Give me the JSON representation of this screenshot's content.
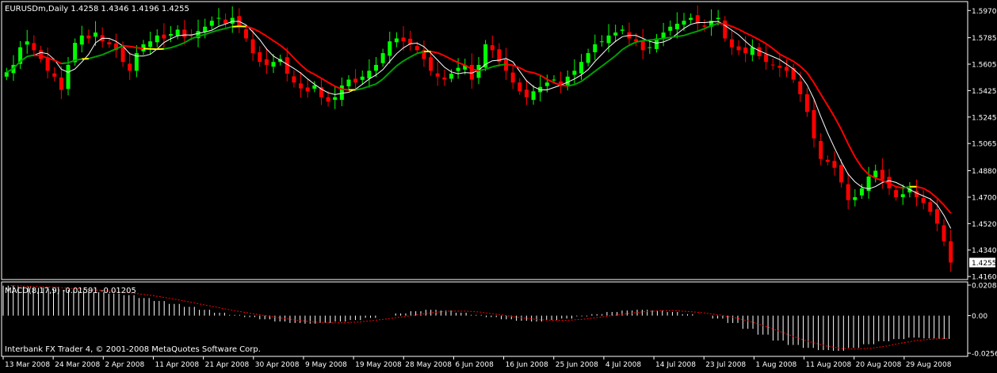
{
  "header": {
    "symbol_line": "EURUSDm,Daily  1.4258 1.4346 1.4196 1.4255"
  },
  "macd": {
    "label": "MACD(8,17,9) -0.01591 -0.01205",
    "scale_labels": [
      "0.02084",
      "0.00",
      "-0.02563"
    ]
  },
  "footer": {
    "copyright": "Interbank FX Trader 4, © 2001-2008 MetaQuotes Software Corp."
  },
  "colors": {
    "background": "#000000",
    "frame": "#ffffff",
    "bull_candle": "#00ff00",
    "bear_candle": "#ff0000",
    "ma_fast": "#ffffff",
    "ma_slow_up": "#00a000",
    "ma_slow_down": "#ff0000",
    "ma_slow_flat": "#ffff00",
    "macd_hist": "#ffffff",
    "macd_signal": "#ff0000"
  },
  "chart_data": {
    "type": "candlestick",
    "title": "EURUSDm,Daily",
    "price_axis_labels": [
      "1.5970",
      "1.5785",
      "1.5605",
      "1.5425",
      "1.5245",
      "1.5065",
      "1.4880",
      "1.4700",
      "1.4520",
      "1.4340",
      "1.4160"
    ],
    "current_price": "1.4255",
    "ylim": [
      1.415,
      1.602
    ],
    "date_labels": [
      "13 Mar 2008",
      "24 Mar 2008",
      "2 Apr 2008",
      "11 Apr 2008",
      "21 Apr 2008",
      "30 Apr 2008",
      "9 May 2008",
      "19 May 2008",
      "28 May 2008",
      "6 Jun 2008",
      "16 Jun 2008",
      "25 Jun 2008",
      "4 Jul 2008",
      "14 Jul 2008",
      "23 Jul 2008",
      "1 Aug 2008",
      "11 Aug 2008",
      "20 Aug 2008",
      "29 Aug 2008"
    ],
    "close_series": [
      1.555,
      1.56,
      1.572,
      1.576,
      1.57,
      1.564,
      1.556,
      1.552,
      1.543,
      1.56,
      1.575,
      1.58,
      1.578,
      1.582,
      1.576,
      1.574,
      1.57,
      1.562,
      1.556,
      1.568,
      1.574,
      1.576,
      1.58,
      1.578,
      1.581,
      1.584,
      1.579,
      1.58,
      1.583,
      1.586,
      1.59,
      1.592,
      1.588,
      1.592,
      1.586,
      1.578,
      1.568,
      1.562,
      1.56,
      1.562,
      1.564,
      1.554,
      1.548,
      1.544,
      1.542,
      1.546,
      1.538,
      1.535,
      1.538,
      1.546,
      1.55,
      1.548,
      1.552,
      1.556,
      1.56,
      1.568,
      1.576,
      1.578,
      1.576,
      1.574,
      1.57,
      1.564,
      1.556,
      1.552,
      1.55,
      1.554,
      1.558,
      1.56,
      1.55,
      1.56,
      1.574,
      1.57,
      1.562,
      1.556,
      1.548,
      1.542,
      1.538,
      1.542,
      1.545,
      1.548,
      1.55,
      1.546,
      1.552,
      1.556,
      1.562,
      1.568,
      1.574,
      1.576,
      1.58,
      1.582,
      1.584,
      1.578,
      1.576,
      1.57,
      1.572,
      1.578,
      1.582,
      1.586,
      1.588,
      1.59,
      1.592,
      1.588,
      1.586,
      1.59,
      1.592,
      1.578,
      1.572,
      1.57,
      1.568,
      1.572,
      1.566,
      1.562,
      1.56,
      1.558,
      1.556,
      1.55,
      1.54,
      1.528,
      1.51,
      1.496,
      1.494,
      1.49,
      1.48,
      1.468,
      1.47,
      1.476,
      1.484,
      1.488,
      1.482,
      1.476,
      1.47,
      1.472,
      1.476,
      1.47,
      1.466,
      1.46,
      1.452,
      1.44,
      1.4255
    ],
    "macd_histogram": [
      0.0205,
      0.0198,
      0.019,
      0.0182,
      0.0176,
      0.017,
      0.016,
      0.015,
      0.014,
      0.012,
      0.01,
      0.008,
      0.006,
      0.004,
      0.002,
      0.0005,
      -0.001,
      -0.0025,
      -0.004,
      -0.005,
      -0.0055,
      -0.005,
      -0.004,
      -0.003,
      -0.0015,
      0.0,
      0.0015,
      0.003,
      0.004,
      0.0035,
      0.002,
      0.0005,
      -0.001,
      -0.0025,
      -0.0035,
      -0.004,
      -0.003,
      -0.002,
      -0.0005,
      0.001,
      0.0025,
      0.0035,
      0.004,
      0.0035,
      0.0025,
      0.001,
      0.0,
      -0.002,
      -0.005,
      -0.009,
      -0.013,
      -0.017,
      -0.02,
      -0.022,
      -0.0235,
      -0.024,
      -0.022,
      -0.0195,
      -0.0175,
      -0.016,
      -0.015,
      -0.0155,
      -0.0159
    ]
  }
}
